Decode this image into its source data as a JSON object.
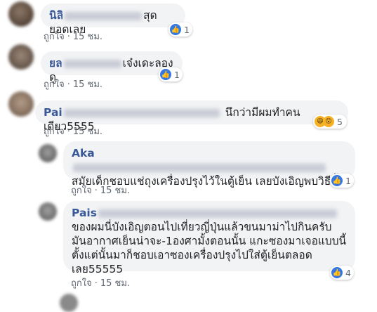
{
  "colors": {
    "bubble_bg": "#f2f3f5",
    "name": "#385898",
    "meta": "#606770",
    "like_icon": "#3578e5"
  },
  "comments": [
    {
      "name_visible": "นิลิ",
      "text": "สุดยอดเลย",
      "like_label": "ถูกใจ",
      "time": "15 ชม.",
      "reactions": {
        "icons": [
          "like-icon"
        ],
        "count": "1"
      }
    },
    {
      "name_visible": "ยล",
      "text": "เจ๋งเดะลองดู",
      "like_label": "ถูกใจ",
      "time": "15 ชม.",
      "reactions": {
        "icons": [
          "like-icon"
        ],
        "count": "1"
      }
    },
    {
      "name_visible": "Pai",
      "text": "นึกว่ามีผมทำคนเดียว5555",
      "like_label": "ถูกใจ",
      "time": "15 ชม.",
      "reactions": {
        "icons": [
          "haha-icon",
          "wow-icon"
        ],
        "count": "5"
      }
    },
    {
      "name_visible": "Aka",
      "text": "สมัยเด็กชอบแช่ถุงเครื่องปรุงไว้ในตู้เย็น เลยบังเอิญพบวิธีนี้",
      "like_label": "ถูกใจ",
      "time": "15 ชม.",
      "reactions": {
        "icons": [
          "like-icon"
        ],
        "count": "1"
      }
    },
    {
      "name_visible": "Pais",
      "text_lines": [
        "ของผมนี่บังเอิญตอนไปเที่ยวญี่ปุ่นแล้วขนมาม่าไปกินครับ",
        "มันอากาศเย็นน่าจะ-1องศามั้งตอนนั้น แกะซองมาเจอแบบนี้",
        "ตั้งแต่นั้นมาก็ชอบเอาซองเครื่องปรุงไปใส่ตู้เย็นตลอด",
        "เลย55555"
      ],
      "like_label": "ถูกใจ",
      "time": "15 ชม.",
      "reactions": {
        "icons": [
          "like-icon"
        ],
        "count": "4"
      }
    }
  ]
}
